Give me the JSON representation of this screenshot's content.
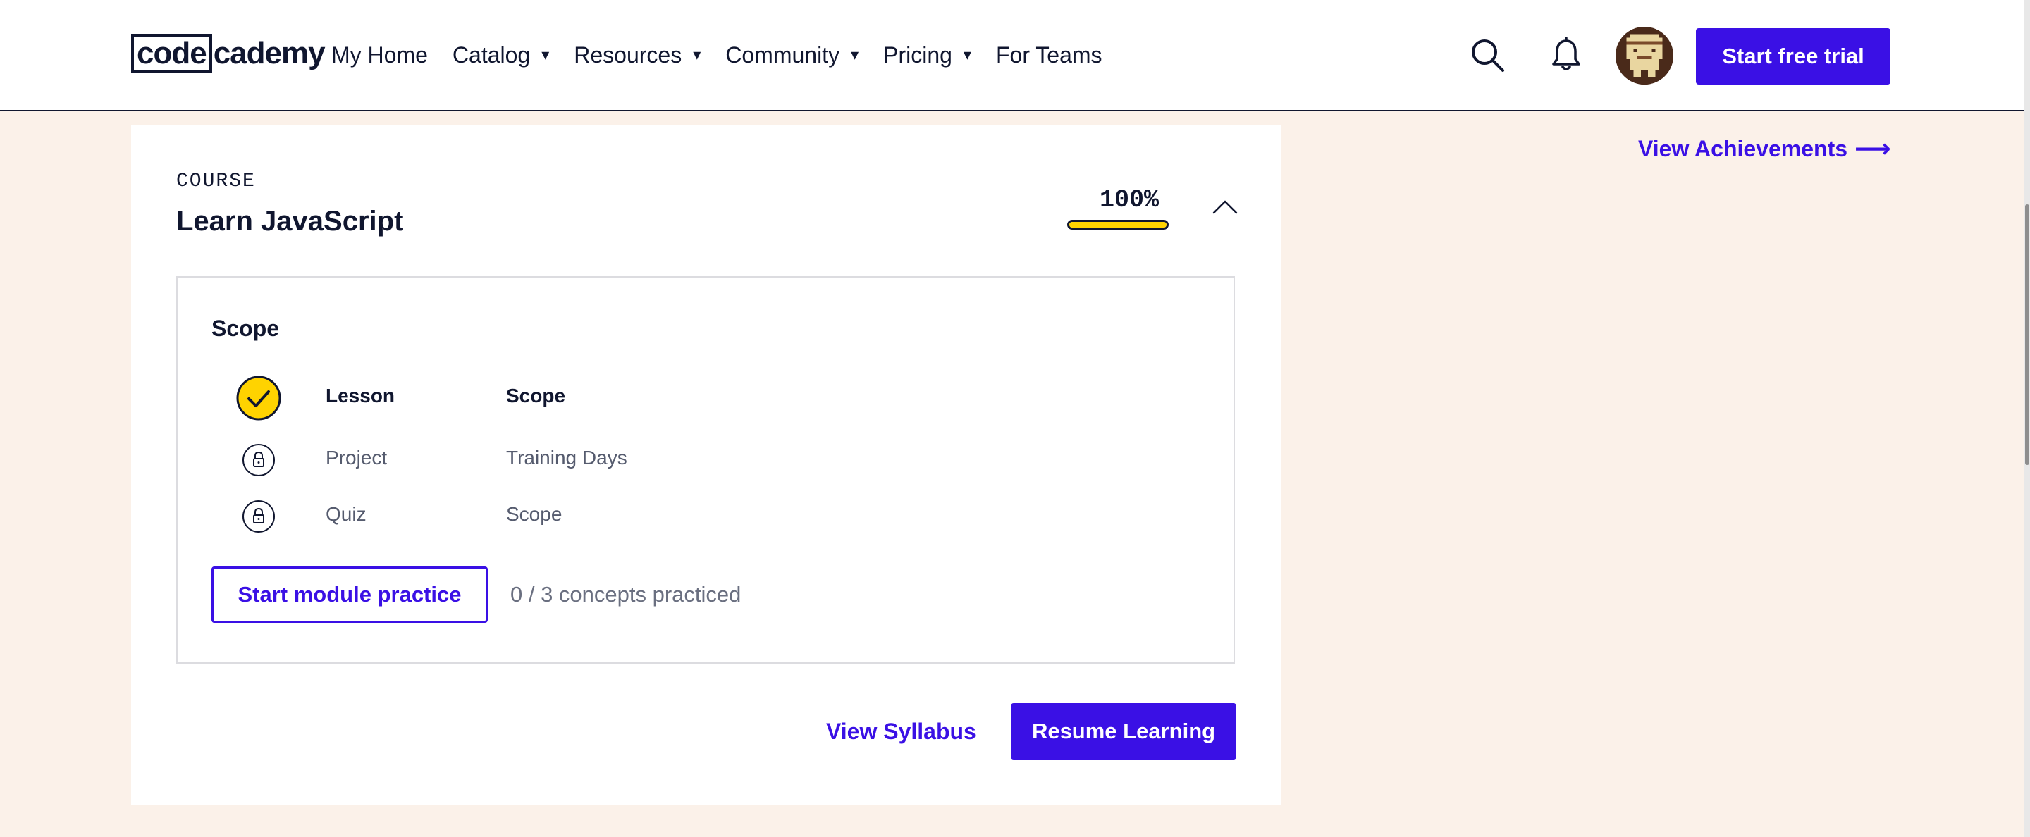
{
  "header": {
    "logo": {
      "part1": "code",
      "part2": "cademy"
    },
    "nav": [
      {
        "label": "My Home",
        "dropdown": false
      },
      {
        "label": "Catalog",
        "dropdown": true
      },
      {
        "label": "Resources",
        "dropdown": true
      },
      {
        "label": "Community",
        "dropdown": true
      },
      {
        "label": "Pricing",
        "dropdown": true
      },
      {
        "label": "For Teams",
        "dropdown": false
      }
    ],
    "icons": {
      "search": "search-icon",
      "notifications": "bell-icon",
      "caret": "▾"
    },
    "cta_label": "Start free trial"
  },
  "course_card": {
    "eyebrow": "COURSE",
    "title": "Learn JavaScript",
    "progress_label": "100%",
    "progress_fraction": 1.0,
    "module": {
      "title": "Scope",
      "items": [
        {
          "kind": "Lesson",
          "name": "Scope",
          "status": "completed"
        },
        {
          "kind": "Project",
          "name": "Training Days",
          "status": "locked"
        },
        {
          "kind": "Quiz",
          "name": "Scope",
          "status": "locked"
        }
      ],
      "practice_button": "Start module practice",
      "practice_count": "0 / 3 concepts practiced"
    },
    "syllabus_link": "View Syllabus",
    "resume_button": "Resume Learning"
  },
  "sidebar": {
    "achievements_link": "View Achievements",
    "achievements_arrow": "⟶"
  },
  "colors": {
    "brand": "#3a10e5",
    "navy": "#10162f",
    "yellow": "#ffd300",
    "page_bg": "#fbf1e9"
  }
}
